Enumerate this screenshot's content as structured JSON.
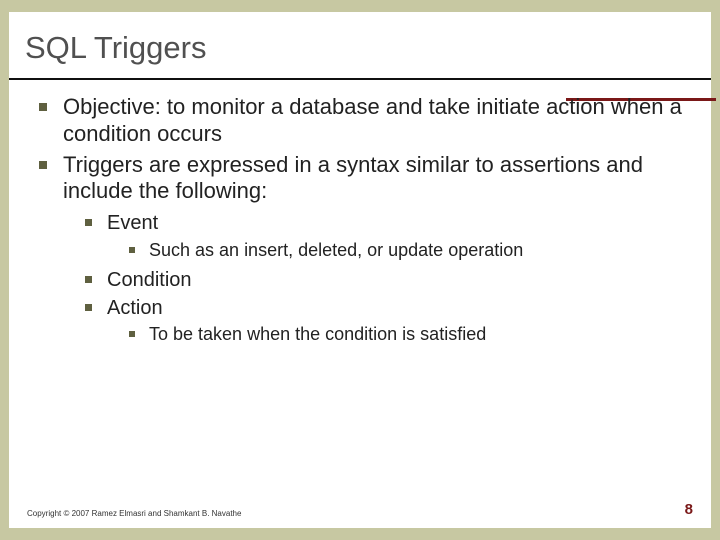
{
  "title": "SQL Triggers",
  "bullets": {
    "b1": "Objective: to monitor a database and take initiate action when a condition occurs",
    "b2": "Triggers are expressed in a syntax similar to assertions and include the following:",
    "sub": {
      "event": "Event",
      "event_detail": "Such as an insert, deleted, or update operation",
      "condition": "Condition",
      "action": "Action",
      "action_detail": "To be taken when the condition is satisfied"
    }
  },
  "footer": {
    "copyright": "Copyright © 2007 Ramez Elmasri and Shamkant B. Navathe",
    "page": "8"
  }
}
